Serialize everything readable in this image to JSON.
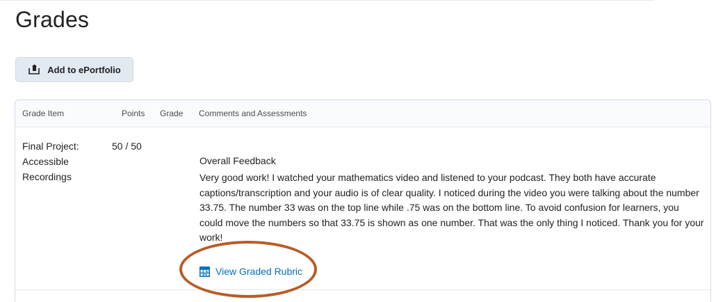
{
  "page": {
    "title": "Grades"
  },
  "toolbar": {
    "add_portfolio_label": "Add to ePortfolio"
  },
  "table": {
    "headers": {
      "grade_item": "Grade Item",
      "points": "Points",
      "grade": "Grade",
      "comments": "Comments and Assessments"
    },
    "rows": [
      {
        "grade_item": "Final Project: Accessible Recordings",
        "points": "50 / 50",
        "grade": "",
        "feedback_title": "Overall Feedback",
        "feedback_text": "Very good work! I watched your mathematics video and listened to your podcast. They both have accurate captions/transcription and your audio is of clear quality. I noticed during the video you were talking about the number 33.75. The number 33 was on the top line while .75 was on the bottom line. To avoid confusion for learners, you could move the numbers so that 33.75 is shown as one number. That was the only thing I noticed. Thank you for your work!",
        "rubric_link": "View Graded Rubric"
      }
    ]
  },
  "icons": {
    "portfolio": "export-to-portfolio-icon",
    "rubric": "rubric-icon"
  },
  "colors": {
    "link": "#006fbf",
    "button_bg": "#e3e9f1",
    "annotation": "#b85c27"
  }
}
